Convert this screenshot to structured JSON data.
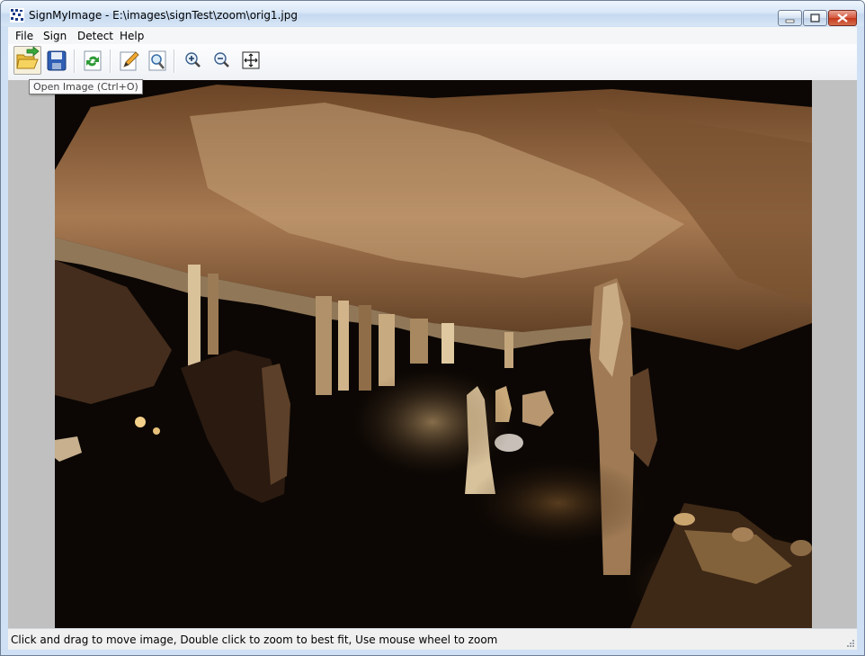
{
  "window": {
    "title": "SignMyImage - E:\\images\\signTest\\zoom\\orig1.jpg",
    "app_icon": "signmyimage-app-icon",
    "controls": [
      "minimize-icon",
      "restore-icon",
      "close-icon"
    ]
  },
  "menu": {
    "items": [
      {
        "label": "File"
      },
      {
        "label": "Sign"
      },
      {
        "label": "Detect"
      },
      {
        "label": "Help"
      }
    ]
  },
  "toolbar": {
    "buttons": [
      {
        "icon": "open-folder-icon",
        "state": "hover"
      },
      {
        "icon": "save-disk-icon"
      },
      {
        "icon": "refresh-icon"
      },
      {
        "icon": "sign-pencil-icon"
      },
      {
        "icon": "detect-magnifier-icon"
      },
      {
        "icon": "zoom-in-icon"
      },
      {
        "icon": "zoom-out-icon"
      },
      {
        "icon": "fit-to-window-icon"
      }
    ]
  },
  "tooltip": {
    "text": "Open Image (Ctrl+O)"
  },
  "image_view": {
    "content": "cave-stalactites-photo"
  },
  "status": {
    "text": "Click and drag to move image, Double click to zoom to best fit, Use mouse wheel to zoom"
  },
  "colors": {
    "titlebar": "#d6e5f6",
    "viewport_background": "#c0c0c0",
    "close_button": "#c5391c"
  }
}
